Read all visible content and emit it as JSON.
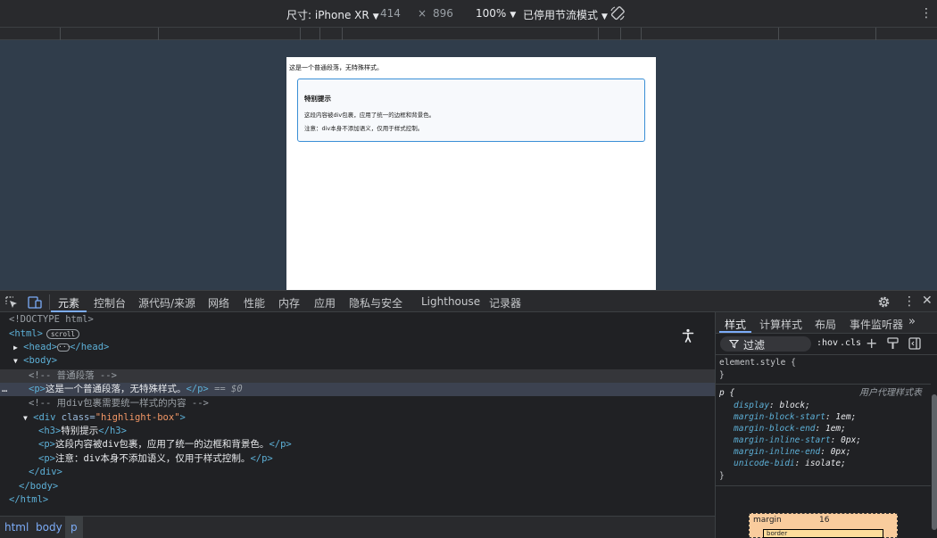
{
  "device_toolbar": {
    "dimensions_label": "尺寸: iPhone XR",
    "width": "414",
    "times": "×",
    "height": "896",
    "zoom": "100%",
    "throttle": "已停用节流模式"
  },
  "preview": {
    "plain_paragraph": "这是一个普通段落，无特殊样式。",
    "box_title": "特别提示",
    "box_p1": "这段内容被div包裹，应用了统一的边框和背景色。",
    "box_p2": "注意：div本身不添加语义，仅用于样式控制。"
  },
  "devtools_tabs": [
    "元素",
    "控制台",
    "源代码/来源",
    "网络",
    "性能",
    "内存",
    "应用",
    "隐私与安全",
    "Lighthouse",
    "记录器"
  ],
  "elements_tree": {
    "doctype": "<!DOCTYPE html>",
    "html_open": "<html>",
    "scroll_badge": "scroll",
    "head_open": "<head>",
    "head_close": "</head>",
    "body_open": "<body>",
    "comment1": "<!-- 普通段落 -->",
    "p_open": "<p>",
    "p1_text": "这是一个普通段落，无特殊样式。",
    "p_close": "</p>",
    "selected_marker": "== $0",
    "comment2": "<!-- 用div包裹需要统一样式的内容 -->",
    "div_open_tag": "<div ",
    "div_attr_name": "class=",
    "div_attr_value": "\"highlight-box\"",
    "div_open_end": ">",
    "h3_open": "<h3>",
    "h3_text": "特别提示",
    "h3_close": "</h3>",
    "p2_text": "这段内容被div包裹，应用了统一的边框和背景色。",
    "p3_text": "注意：div本身不添加语义，仅用于样式控制。",
    "div_close": "</div>",
    "body_close": "</body>",
    "html_close": "</html>",
    "row_dots": "…"
  },
  "breadcrumbs": [
    "html",
    "body",
    "p"
  ],
  "styles_tabs": [
    "样式",
    "计算样式",
    "布局",
    "事件监听器"
  ],
  "styles": {
    "filter_label": "过滤",
    "hov": ":hov",
    "cls": ".cls",
    "element_style": "element.style {",
    "close_brace": "}",
    "p_selector": "p {",
    "user_agent": "用户代理样式表",
    "props": [
      {
        "name": "display",
        "value": "block;"
      },
      {
        "name": "margin-block-start",
        "value": "1em;"
      },
      {
        "name": "margin-block-end",
        "value": "1em;"
      },
      {
        "name": "margin-inline-start",
        "value": "0px;"
      },
      {
        "name": "margin-inline-end",
        "value": "0px;"
      },
      {
        "name": "unicode-bidi",
        "value": "isolate;"
      }
    ],
    "box_margin_label": "margin",
    "box_margin_value": "16",
    "box_border_label": "border"
  }
}
